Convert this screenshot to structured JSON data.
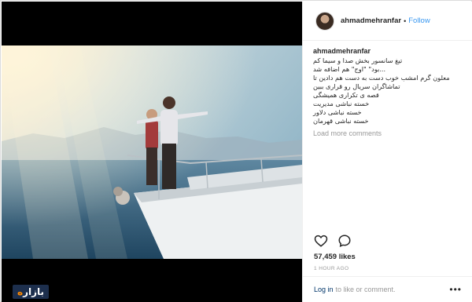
{
  "post": {
    "username": "ahmadmehranfar",
    "follow_label": "Follow",
    "dot": "•",
    "caption_username": "ahmadmehranfar",
    "caption_lines": [
      "تیغ سانسور بخش صدا و سیما کم",
      "...بود\" \"اوج\" هم اضافه شد",
      "معلون گرم امشب خوب دست به دست هم دادین تا",
      "تماشاگران سریال رو قراری ببین",
      "قصه ی تکراری همیشگی",
      "خسته نباشی مدیریت",
      "خسته نباشی دلاور",
      "خسته نباشی قهرمان"
    ],
    "load_more": "Load more comments",
    "likes": "57,459 likes",
    "time": "1 HOUR AGO",
    "login_link": "Log in",
    "login_rest": "to like or comment.",
    "more": "•••"
  },
  "icons": {
    "like": "heart-icon",
    "comment": "comment-bubble-icon",
    "more": "more-options-icon"
  },
  "watermark": {
    "main": "بازار",
    "accent": "ه"
  },
  "colors": {
    "link_blue": "#3897f0",
    "login_blue": "#003569",
    "muted": "#999999",
    "border": "#dbdbdb"
  }
}
